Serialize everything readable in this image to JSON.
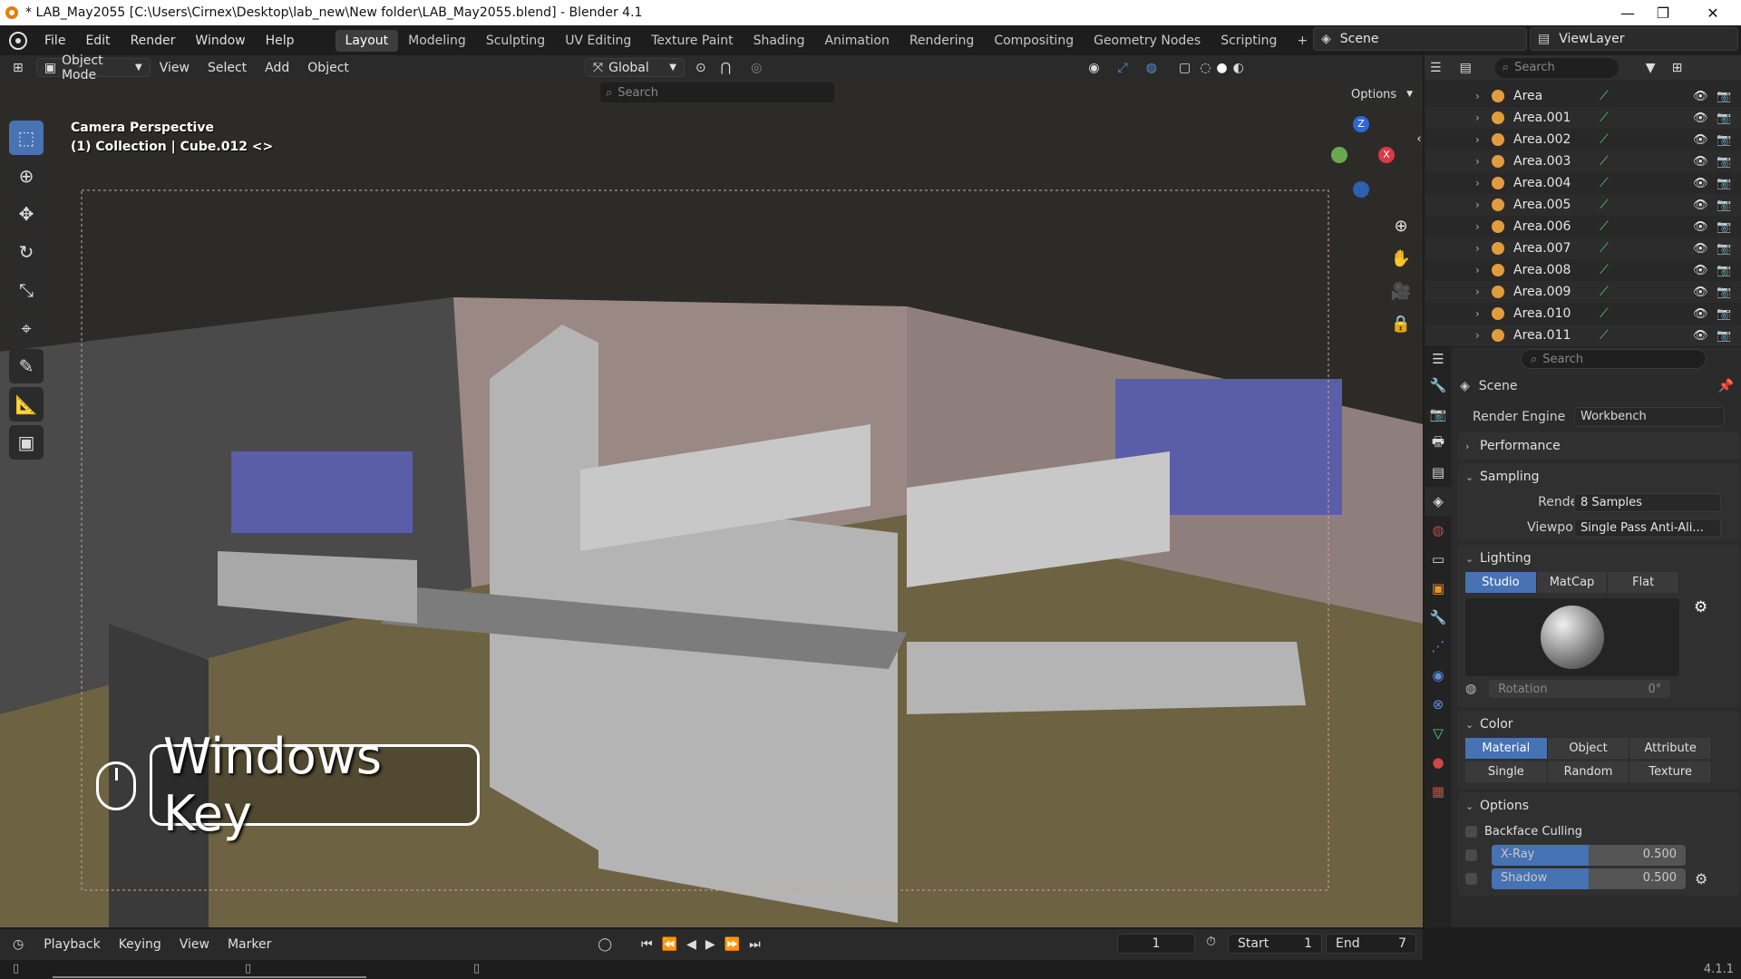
{
  "window": {
    "title": "* LAB_May2055 [C:\\Users\\Cirnex\\Desktop\\lab_new\\New folder\\LAB_May2055.blend] - Blender 4.1",
    "minimize": "—",
    "maximize": "❐",
    "close": "✕"
  },
  "menubar": {
    "items": [
      "File",
      "Edit",
      "Render",
      "Window",
      "Help"
    ],
    "workspaces": [
      "Layout",
      "Modeling",
      "Sculpting",
      "UV Editing",
      "Texture Paint",
      "Shading",
      "Animation",
      "Rendering",
      "Compositing",
      "Geometry Nodes",
      "Scripting"
    ],
    "active_workspace": "Layout",
    "add_workspace": "+",
    "scene": "Scene",
    "view_layer": "ViewLayer"
  },
  "viewport_header": {
    "mode": "Object Mode",
    "menus": [
      "View",
      "Select",
      "Add",
      "Object"
    ],
    "transform_orientation": "Global",
    "search_placeholder": "Search",
    "options": "Options"
  },
  "viewport": {
    "camera_label": "Camera Perspective",
    "collection_label": "(1) Collection | Cube.012 <>",
    "key_overlay": "Windows Key",
    "gizmo": {
      "z": "Z",
      "x": "X"
    },
    "colors": {
      "ceiling": "#2c2b28",
      "wall": "#9a8884",
      "window": "#5a5ea8",
      "floor": "#6d6242",
      "cabinet": "#b4b4b4"
    }
  },
  "outliner": {
    "search_placeholder": "Search",
    "items": [
      "Area",
      "Area.001",
      "Area.002",
      "Area.003",
      "Area.004",
      "Area.005",
      "Area.006",
      "Area.007",
      "Area.008",
      "Area.009",
      "Area.010",
      "Area.011"
    ]
  },
  "properties": {
    "search_placeholder": "Search",
    "context": "Scene",
    "render_engine_label": "Render Engine",
    "render_engine": "Workbench",
    "performance": "Performance",
    "sampling": "Sampling",
    "render_label": "Render",
    "render_samples": "8 Samples",
    "viewport_label": "Viewport",
    "viewport_samples": "Single Pass Anti-Ali...",
    "lighting": "Lighting",
    "lighting_modes": [
      "Studio",
      "MatCap",
      "Flat"
    ],
    "lighting_active": "Studio",
    "rotation_label": "Rotation",
    "rotation_value": "0°",
    "color": "Color",
    "color_modes": [
      "Material",
      "Object",
      "Attribute",
      "Single",
      "Random",
      "Texture"
    ],
    "color_active": "Material",
    "options": "Options",
    "backface_culling": "Backface Culling",
    "xray_label": "X-Ray",
    "xray_value": "0.500",
    "xray_fraction": 0.5,
    "shadow_label": "Shadow",
    "shadow_value": "0.500",
    "shadow_fraction": 0.5
  },
  "timeline": {
    "menus": [
      "Playback",
      "Keying",
      "View",
      "Marker"
    ],
    "current_frame": "1",
    "start_label": "Start",
    "start_value": "1",
    "end_label": "End",
    "end_value": "7"
  },
  "statusbar": {
    "version": "4.1.1"
  }
}
